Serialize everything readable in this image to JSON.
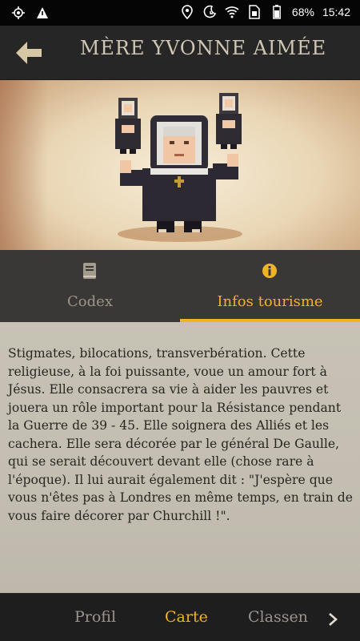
{
  "status": {
    "battery": "68%",
    "time": "15:42"
  },
  "header": {
    "title": "MÈRE YVONNE AIMÉE"
  },
  "tabs": [
    {
      "label": "Codex",
      "icon": "book-icon"
    },
    {
      "label": "Infos tourisme",
      "icon": "info-icon",
      "active": true
    }
  ],
  "content": {
    "text": "Stigmates, bilocations, transverbération. Cette religieuse, à la foi puissante, voue un amour fort à Jésus. Elle consacrera sa vie à aider les pauvres et jouera un rôle important pour la Résistance pendant la Guerre de 39 - 45. Elle soignera des Alliés et les cachera. Elle sera décorée par le général De Gaulle, qui se serait découvert devant elle (chose rare à l'époque). Il lui aurait également dit : \"J'espère que vous n'êtes pas à Londres en même temps, en train de vous faire décorer par Churchill !\"."
  },
  "bottom_nav": {
    "profil": "Profil",
    "carte": "Carte",
    "classement": "Classen"
  },
  "colors": {
    "accent": "#f0b323",
    "header_bg": "#262626",
    "content_bg": "#c7c2b5"
  }
}
